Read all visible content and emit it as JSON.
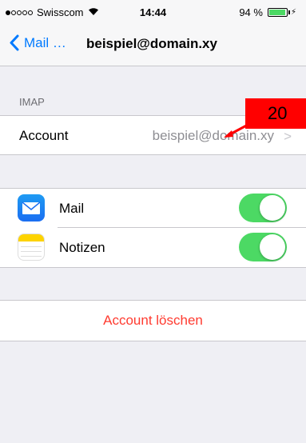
{
  "status_bar": {
    "carrier": "Swisscom",
    "time": "14:44",
    "battery_percent_text": "94 %",
    "battery_level": 0.94
  },
  "nav": {
    "back_label": "Mail …",
    "title": "beispiel@domain.xy"
  },
  "imap_section": {
    "header": "IMAP",
    "account_label": "Account",
    "account_value": "beispiel@domain.xy"
  },
  "apps": [
    {
      "label": "Mail",
      "icon": "mail-icon",
      "enabled": true
    },
    {
      "label": "Notizen",
      "icon": "notes-icon",
      "enabled": true
    }
  ],
  "delete_label": "Account löschen",
  "badge": "20",
  "colors": {
    "accent": "#007aff",
    "toggle_on": "#4cd964",
    "destructive": "#ff3b30",
    "badge": "#ff0000"
  }
}
